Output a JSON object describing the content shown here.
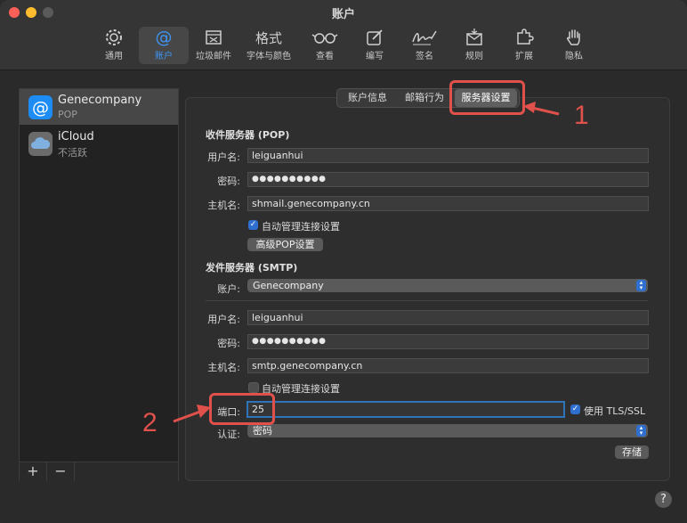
{
  "window": {
    "title": "账户"
  },
  "toolbar": {
    "items": [
      {
        "label": "通用",
        "icon": "gear-icon"
      },
      {
        "label": "账户",
        "icon": "at-icon"
      },
      {
        "label": "垃圾邮件",
        "icon": "junk-mail-icon"
      },
      {
        "label": "字体与颜色",
        "icon": "font-icon"
      },
      {
        "label": "查看",
        "icon": "glasses-icon"
      },
      {
        "label": "编写",
        "icon": "compose-icon"
      },
      {
        "label": "签名",
        "icon": "signature-icon"
      },
      {
        "label": "规则",
        "icon": "rules-icon"
      },
      {
        "label": "扩展",
        "icon": "puzzle-icon"
      },
      {
        "label": "隐私",
        "icon": "hand-icon"
      }
    ],
    "active_index": 1
  },
  "sidebar": {
    "accounts": [
      {
        "name": "Genecompany",
        "sub": "POP",
        "icon": "mail-account-icon",
        "selected": true
      },
      {
        "name": "iCloud",
        "sub": "不活跃",
        "icon": "icloud-icon",
        "selected": false
      }
    ],
    "add_label": "+",
    "remove_label": "−"
  },
  "tabs": {
    "items": [
      "账户信息",
      "邮箱行为",
      "服务器设置"
    ],
    "selected_index": 2
  },
  "incoming": {
    "section_title": "收件服务器 (POP)",
    "username_label": "用户名:",
    "username_value": "leiguanhui",
    "password_label": "密码:",
    "password_value": "●●●●●●●●●●",
    "hostname_label": "主机名:",
    "hostname_value": "shmail.genecompany.cn",
    "auto_manage_label": "自动管理连接设置",
    "auto_manage_checked": true,
    "advanced_button": "高级POP设置"
  },
  "outgoing": {
    "section_title": "发件服务器 (SMTP)",
    "account_label": "账户:",
    "account_value": "Genecompany",
    "username_label": "用户名:",
    "username_value": "leiguanhui",
    "password_label": "密码:",
    "password_value": "●●●●●●●●●●",
    "hostname_label": "主机名:",
    "hostname_value": "smtp.genecompany.cn",
    "auto_manage_label": "自动管理连接设置",
    "auto_manage_checked": false,
    "port_label": "端口:",
    "port_value": "25",
    "tls_label": "使用 TLS/SSL",
    "tls_checked": true,
    "auth_label": "认证:",
    "auth_value": "密码"
  },
  "save_button": "存储",
  "help_label": "?",
  "annotations": {
    "one": "1",
    "two": "2",
    "color": "#e0514b"
  },
  "colors": {
    "accent": "#2e6fd0",
    "highlight": "#e0514b",
    "active_tab_text": "#3d95f5"
  }
}
